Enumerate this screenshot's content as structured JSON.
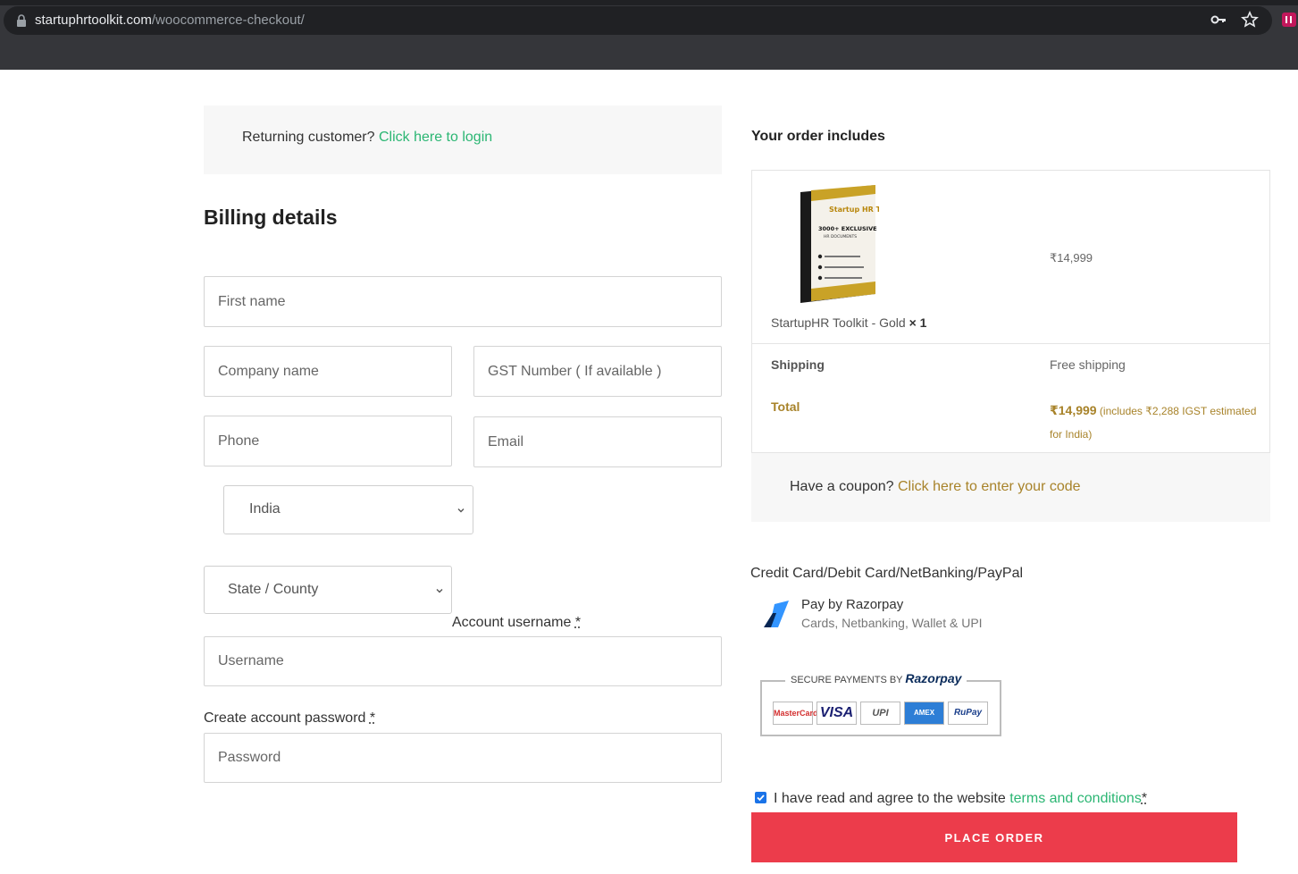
{
  "browser": {
    "url_host": "startuphrtoolkit.com",
    "url_path": "/woocommerce-checkout/"
  },
  "returning": {
    "prompt": "Returning customer?",
    "link": "Click here to login"
  },
  "billing": {
    "title": "Billing details",
    "first_name_placeholder": "First name",
    "company_placeholder": "Company name",
    "gst_placeholder": "GST Number ( If available )",
    "phone_placeholder": "Phone",
    "email_placeholder": "Email",
    "country_value": "India",
    "state_value": "State / County",
    "username_label": "Account username",
    "username_placeholder": "Username",
    "password_label": "Create account password",
    "password_placeholder": "Password",
    "required_mark": "*"
  },
  "order": {
    "title": "Your order includes",
    "product_name": "StartupHR Toolkit - Gold",
    "product_qty": "× 1",
    "product_price": "₹14,999",
    "product_box_text": {
      "brand": "Startup HR Toolkit",
      "headline": "3000+ EXCLUSIVE",
      "sub": "HR DOCUMENTS"
    },
    "shipping_label": "Shipping",
    "shipping_value": "Free shipping",
    "total_label": "Total",
    "total_value": "₹14,999",
    "total_note": "(includes ₹2,288 IGST estimated for India)"
  },
  "coupon": {
    "prompt": "Have a coupon?",
    "link": "Click here to enter your code"
  },
  "payment": {
    "method": "Credit Card/Debit Card/NetBanking/PayPal",
    "provider_title": "Pay by Razorpay",
    "provider_sub": "Cards, Netbanking, Wallet & UPI",
    "secure_label": "SECURE PAYMENTS BY",
    "secure_brand": "Razorpay",
    "cards": [
      "MasterCard",
      "VISA",
      "UPI",
      "AMEX",
      "RuPay"
    ]
  },
  "terms": {
    "text": "I have read and agree to the website",
    "link": "terms and conditions",
    "required_mark": "*"
  },
  "place_order": "PLACE ORDER",
  "colors": {
    "accent_green": "#2bb673",
    "accent_gold": "#a8832a",
    "button_red": "#ec3c4b"
  }
}
